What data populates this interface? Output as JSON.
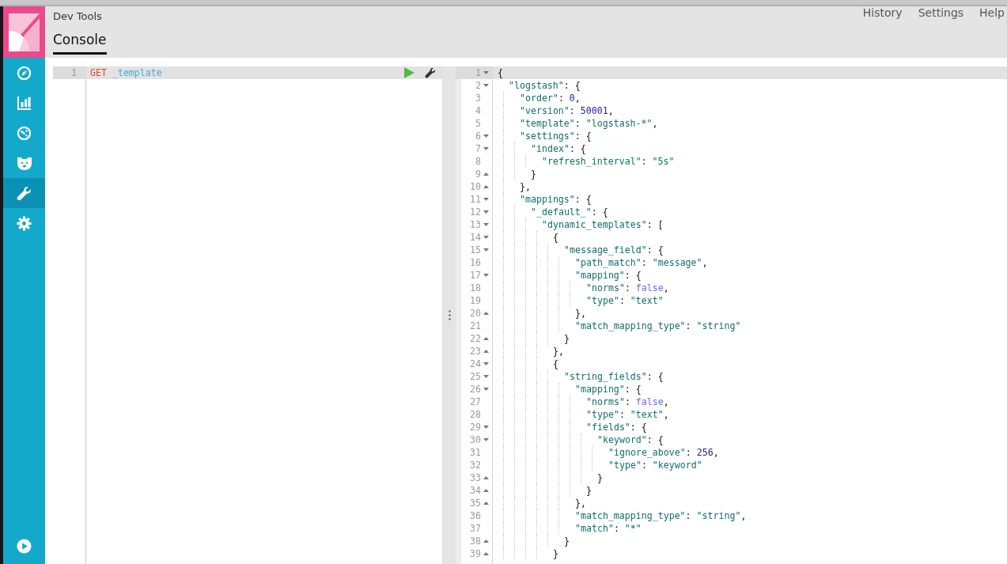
{
  "sidebar": {
    "items": [
      {
        "selected": false
      },
      {
        "selected": false
      },
      {
        "selected": false
      },
      {
        "selected": false
      },
      {
        "selected": true
      },
      {
        "selected": false
      }
    ],
    "bottom_item": {
      "selected": false
    }
  },
  "header": {
    "app_title": "Dev Tools",
    "tabs": [
      {
        "label": "Console",
        "selected": true
      }
    ],
    "menu": [
      "History",
      "Settings",
      "Help"
    ]
  },
  "request_editor": {
    "lines": [
      {
        "n": "1",
        "active": true,
        "method": "GET",
        "path": "_template"
      }
    ]
  },
  "response": {
    "lines": [
      {
        "n": "1",
        "kind": "open",
        "active": true,
        "tokens": [
          {
            "kind": "punct",
            "text": "{"
          }
        ],
        "children": [
          {
            "n": "2",
            "kind": "open",
            "active": false,
            "tokens": [
              {
                "kind": "key",
                "text": "\"logstash\""
              },
              {
                "kind": "punct",
                "text": ": {"
              }
            ],
            "children": [
              {
                "n": "3",
                "kind": "plain",
                "active": false,
                "tokens": [
                  {
                    "kind": "key",
                    "text": "\"order\""
                  },
                  {
                    "kind": "punct",
                    "text": ": "
                  },
                  {
                    "kind": "number",
                    "text": "0"
                  },
                  {
                    "kind": "punct",
                    "text": ","
                  }
                ]
              },
              {
                "n": "4",
                "kind": "plain",
                "active": false,
                "tokens": [
                  {
                    "kind": "key",
                    "text": "\"version\""
                  },
                  {
                    "kind": "punct",
                    "text": ": "
                  },
                  {
                    "kind": "number",
                    "text": "50001"
                  },
                  {
                    "kind": "punct",
                    "text": ","
                  }
                ]
              },
              {
                "n": "5",
                "kind": "plain",
                "active": false,
                "tokens": [
                  {
                    "kind": "key",
                    "text": "\"template\""
                  },
                  {
                    "kind": "punct",
                    "text": ": "
                  },
                  {
                    "kind": "string",
                    "text": "\"logstash-*\""
                  },
                  {
                    "kind": "punct",
                    "text": ","
                  }
                ]
              },
              {
                "n": "6",
                "kind": "open",
                "active": false,
                "tokens": [
                  {
                    "kind": "key",
                    "text": "\"settings\""
                  },
                  {
                    "kind": "punct",
                    "text": ": {"
                  }
                ],
                "children": [
                  {
                    "n": "7",
                    "kind": "open",
                    "active": false,
                    "tokens": [
                      {
                        "kind": "key",
                        "text": "\"index\""
                      },
                      {
                        "kind": "punct",
                        "text": ": {"
                      }
                    ],
                    "children": [
                      {
                        "n": "8",
                        "kind": "plain",
                        "active": false,
                        "tokens": [
                          {
                            "kind": "key",
                            "text": "\"refresh_interval\""
                          },
                          {
                            "kind": "punct",
                            "text": ": "
                          },
                          {
                            "kind": "string",
                            "text": "\"5s\""
                          }
                        ]
                      }
                    ]
                  },
                  {
                    "n": "9",
                    "kind": "close",
                    "active": false,
                    "tokens": [
                      {
                        "kind": "punct",
                        "text": "}"
                      }
                    ]
                  }
                ]
              },
              {
                "n": "10",
                "kind": "close",
                "active": false,
                "tokens": [
                  {
                    "kind": "punct",
                    "text": "},"
                  }
                ]
              },
              {
                "n": "11",
                "kind": "open",
                "active": false,
                "tokens": [
                  {
                    "kind": "key",
                    "text": "\"mappings\""
                  },
                  {
                    "kind": "punct",
                    "text": ": {"
                  }
                ],
                "children": [
                  {
                    "n": "12",
                    "kind": "open",
                    "active": false,
                    "tokens": [
                      {
                        "kind": "key",
                        "text": "\"_default_\""
                      },
                      {
                        "kind": "punct",
                        "text": ": {"
                      }
                    ],
                    "children": [
                      {
                        "n": "13",
                        "kind": "open",
                        "active": false,
                        "tokens": [
                          {
                            "kind": "key",
                            "text": "\"dynamic_templates\""
                          },
                          {
                            "kind": "punct",
                            "text": ": ["
                          }
                        ],
                        "children": [
                          {
                            "n": "14",
                            "kind": "open",
                            "active": false,
                            "tokens": [
                              {
                                "kind": "punct",
                                "text": "{"
                              }
                            ],
                            "children": [
                              {
                                "n": "15",
                                "kind": "open",
                                "active": false,
                                "tokens": [
                                  {
                                    "kind": "key",
                                    "text": "\"message_field\""
                                  },
                                  {
                                    "kind": "punct",
                                    "text": ": {"
                                  }
                                ],
                                "children": [
                                  {
                                    "n": "16",
                                    "kind": "plain",
                                    "active": false,
                                    "tokens": [
                                      {
                                        "kind": "key",
                                        "text": "\"path_match\""
                                      },
                                      {
                                        "kind": "punct",
                                        "text": ": "
                                      },
                                      {
                                        "kind": "string",
                                        "text": "\"message\""
                                      },
                                      {
                                        "kind": "punct",
                                        "text": ","
                                      }
                                    ]
                                  },
                                  {
                                    "n": "17",
                                    "kind": "open",
                                    "active": false,
                                    "tokens": [
                                      {
                                        "kind": "key",
                                        "text": "\"mapping\""
                                      },
                                      {
                                        "kind": "punct",
                                        "text": ": {"
                                      }
                                    ],
                                    "children": [
                                      {
                                        "n": "18",
                                        "kind": "plain",
                                        "active": false,
                                        "tokens": [
                                          {
                                            "kind": "key",
                                            "text": "\"norms\""
                                          },
                                          {
                                            "kind": "punct",
                                            "text": ": "
                                          },
                                          {
                                            "kind": "boolean",
                                            "text": "false"
                                          },
                                          {
                                            "kind": "punct",
                                            "text": ","
                                          }
                                        ]
                                      },
                                      {
                                        "n": "19",
                                        "kind": "plain",
                                        "active": false,
                                        "tokens": [
                                          {
                                            "kind": "key",
                                            "text": "\"type\""
                                          },
                                          {
                                            "kind": "punct",
                                            "text": ": "
                                          },
                                          {
                                            "kind": "string",
                                            "text": "\"text\""
                                          }
                                        ]
                                      }
                                    ]
                                  },
                                  {
                                    "n": "20",
                                    "kind": "close",
                                    "active": false,
                                    "tokens": [
                                      {
                                        "kind": "punct",
                                        "text": "},"
                                      }
                                    ]
                                  },
                                  {
                                    "n": "21",
                                    "kind": "plain",
                                    "active": false,
                                    "tokens": [
                                      {
                                        "kind": "key",
                                        "text": "\"match_mapping_type\""
                                      },
                                      {
                                        "kind": "punct",
                                        "text": ": "
                                      },
                                      {
                                        "kind": "string",
                                        "text": "\"string\""
                                      }
                                    ]
                                  }
                                ]
                              },
                              {
                                "n": "22",
                                "kind": "close",
                                "active": false,
                                "tokens": [
                                  {
                                    "kind": "punct",
                                    "text": "}"
                                  }
                                ]
                              }
                            ]
                          },
                          {
                            "n": "23",
                            "kind": "close",
                            "active": false,
                            "tokens": [
                              {
                                "kind": "punct",
                                "text": "},"
                              }
                            ]
                          },
                          {
                            "n": "24",
                            "kind": "open",
                            "active": false,
                            "tokens": [
                              {
                                "kind": "punct",
                                "text": "{"
                              }
                            ],
                            "children": [
                              {
                                "n": "25",
                                "kind": "open",
                                "active": false,
                                "tokens": [
                                  {
                                    "kind": "key",
                                    "text": "\"string_fields\""
                                  },
                                  {
                                    "kind": "punct",
                                    "text": ": {"
                                  }
                                ],
                                "children": [
                                  {
                                    "n": "26",
                                    "kind": "open",
                                    "active": false,
                                    "tokens": [
                                      {
                                        "kind": "key",
                                        "text": "\"mapping\""
                                      },
                                      {
                                        "kind": "punct",
                                        "text": ": {"
                                      }
                                    ],
                                    "children": [
                                      {
                                        "n": "27",
                                        "kind": "plain",
                                        "active": false,
                                        "tokens": [
                                          {
                                            "kind": "key",
                                            "text": "\"norms\""
                                          },
                                          {
                                            "kind": "punct",
                                            "text": ": "
                                          },
                                          {
                                            "kind": "boolean",
                                            "text": "false"
                                          },
                                          {
                                            "kind": "punct",
                                            "text": ","
                                          }
                                        ]
                                      },
                                      {
                                        "n": "28",
                                        "kind": "plain",
                                        "active": false,
                                        "tokens": [
                                          {
                                            "kind": "key",
                                            "text": "\"type\""
                                          },
                                          {
                                            "kind": "punct",
                                            "text": ": "
                                          },
                                          {
                                            "kind": "string",
                                            "text": "\"text\""
                                          },
                                          {
                                            "kind": "punct",
                                            "text": ","
                                          }
                                        ]
                                      },
                                      {
                                        "n": "29",
                                        "kind": "open",
                                        "active": false,
                                        "tokens": [
                                          {
                                            "kind": "key",
                                            "text": "\"fields\""
                                          },
                                          {
                                            "kind": "punct",
                                            "text": ": {"
                                          }
                                        ],
                                        "children": [
                                          {
                                            "n": "30",
                                            "kind": "open",
                                            "active": false,
                                            "tokens": [
                                              {
                                                "kind": "key",
                                                "text": "\"keyword\""
                                              },
                                              {
                                                "kind": "punct",
                                                "text": ": {"
                                              }
                                            ],
                                            "children": [
                                              {
                                                "n": "31",
                                                "kind": "plain",
                                                "active": false,
                                                "tokens": [
                                                  {
                                                    "kind": "key",
                                                    "text": "\"ignore_above\""
                                                  },
                                                  {
                                                    "kind": "punct",
                                                    "text": ": "
                                                  },
                                                  {
                                                    "kind": "number",
                                                    "text": "256"
                                                  },
                                                  {
                                                    "kind": "punct",
                                                    "text": ","
                                                  }
                                                ]
                                              },
                                              {
                                                "n": "32",
                                                "kind": "plain",
                                                "active": false,
                                                "tokens": [
                                                  {
                                                    "kind": "key",
                                                    "text": "\"type\""
                                                  },
                                                  {
                                                    "kind": "punct",
                                                    "text": ": "
                                                  },
                                                  {
                                                    "kind": "string",
                                                    "text": "\"keyword\""
                                                  }
                                                ]
                                              }
                                            ]
                                          },
                                          {
                                            "n": "33",
                                            "kind": "close",
                                            "active": false,
                                            "tokens": [
                                              {
                                                "kind": "punct",
                                                "text": "}"
                                              }
                                            ]
                                          }
                                        ]
                                      },
                                      {
                                        "n": "34",
                                        "kind": "close",
                                        "active": false,
                                        "tokens": [
                                          {
                                            "kind": "punct",
                                            "text": "}"
                                          }
                                        ]
                                      }
                                    ]
                                  },
                                  {
                                    "n": "35",
                                    "kind": "close",
                                    "active": false,
                                    "tokens": [
                                      {
                                        "kind": "punct",
                                        "text": "},"
                                      }
                                    ]
                                  },
                                  {
                                    "n": "36",
                                    "kind": "plain",
                                    "active": false,
                                    "tokens": [
                                      {
                                        "kind": "key",
                                        "text": "\"match_mapping_type\""
                                      },
                                      {
                                        "kind": "punct",
                                        "text": ": "
                                      },
                                      {
                                        "kind": "string",
                                        "text": "\"string\""
                                      },
                                      {
                                        "kind": "punct",
                                        "text": ","
                                      }
                                    ]
                                  },
                                  {
                                    "n": "37",
                                    "kind": "plain",
                                    "active": false,
                                    "tokens": [
                                      {
                                        "kind": "key",
                                        "text": "\"match\""
                                      },
                                      {
                                        "kind": "punct",
                                        "text": ": "
                                      },
                                      {
                                        "kind": "string",
                                        "text": "\"*\""
                                      }
                                    ]
                                  }
                                ]
                              },
                              {
                                "n": "38",
                                "kind": "close",
                                "active": false,
                                "tokens": [
                                  {
                                    "kind": "punct",
                                    "text": "}"
                                  }
                                ]
                              }
                            ]
                          },
                          {
                            "n": "39",
                            "kind": "close",
                            "active": false,
                            "tokens": [
                              {
                                "kind": "punct",
                                "text": "}"
                              }
                            ]
                          }
                        ]
                      }
                    ]
                  }
                ]
              }
            ]
          }
        ]
      }
    ]
  }
}
